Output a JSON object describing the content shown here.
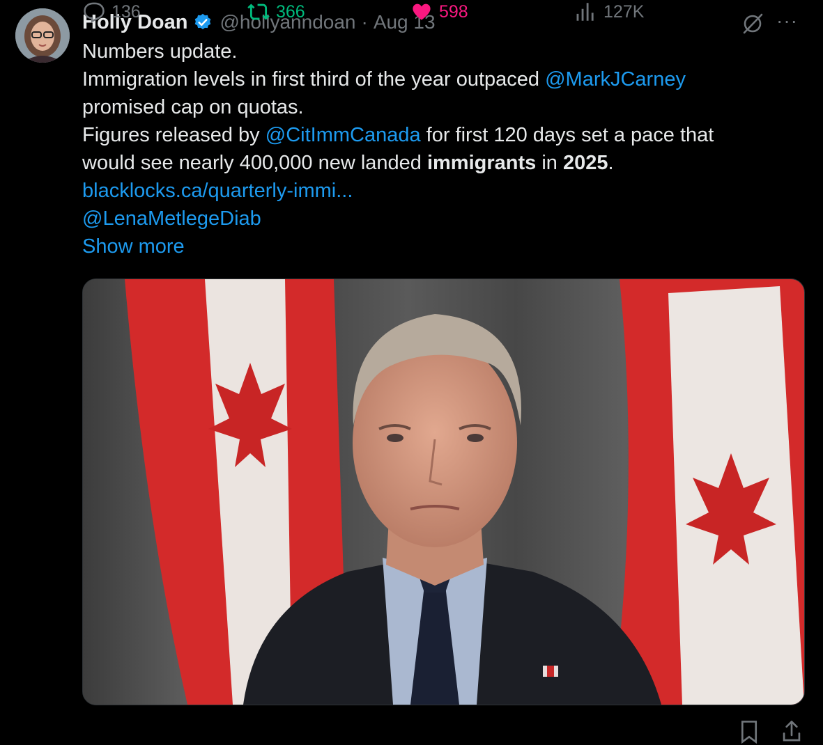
{
  "tweet": {
    "author": {
      "name": "Holly Doan",
      "handle": "@hollyanndoan",
      "verified": true
    },
    "separator": "·",
    "date": "Aug 13",
    "more_label": "···",
    "text": {
      "line1": "Numbers update.",
      "line2_a": "Immigration levels in first third of the year outpaced ",
      "mention1": "@MarkJCarney",
      "line3": "promised cap on quotas.",
      "line4_a": "Figures released by ",
      "mention2": "@CitImmCanada",
      "line4_b": " for first 120 days set a pace that",
      "line5_a": "would see nearly 400,000 new landed ",
      "line5_bold1": "immigrants",
      "line5_b": " in ",
      "line5_bold2": "2025",
      "line5_c": ".",
      "url": "blacklocks.ca/quarterly-immi...",
      "mention3": "@LenaMetlegeDiab",
      "show_more": "Show more"
    },
    "stats": {
      "replies": "136",
      "reposts": "366",
      "likes": "598",
      "views": "127K"
    }
  },
  "colors": {
    "link": "#1d9bf0",
    "repost": "#00ba7c",
    "like": "#f91880",
    "muted": "#71767b",
    "flag_red": "#d32a2a"
  },
  "icons": [
    "verified-badge-icon",
    "grok-icon",
    "more-icon",
    "reply-icon",
    "repost-icon",
    "heart-icon",
    "views-icon",
    "bookmark-icon",
    "share-icon"
  ]
}
